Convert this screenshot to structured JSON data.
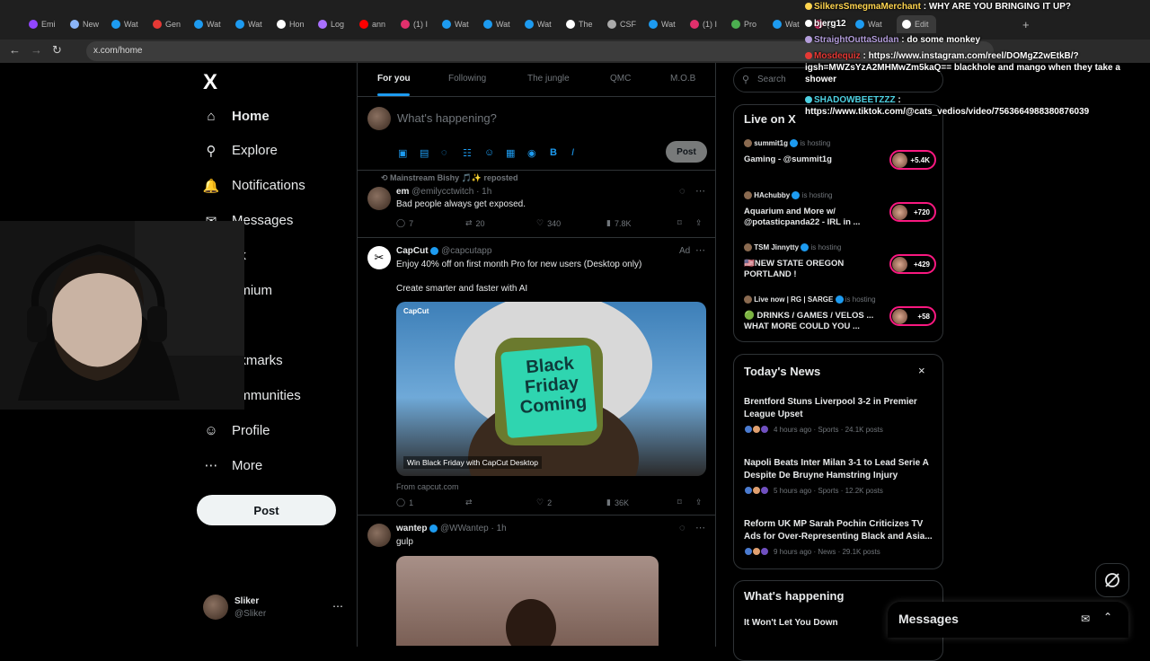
{
  "browser": {
    "url": "x.com/home",
    "tabs": [
      {
        "label": "Emi",
        "color": "#9146ff"
      },
      {
        "label": "New",
        "color": "#8ab4f8"
      },
      {
        "label": "Wat",
        "color": "#1d9bf0"
      },
      {
        "label": "Gen",
        "color": "#e53935"
      },
      {
        "label": "Wat",
        "color": "#1d9bf0"
      },
      {
        "label": "Wat",
        "color": "#1d9bf0"
      },
      {
        "label": "Hon",
        "color": "#ffffff"
      },
      {
        "label": "Log",
        "color": "#a970ff"
      },
      {
        "label": "ann",
        "color": "#ff0000"
      },
      {
        "label": "(1) I",
        "color": "#e1306c"
      },
      {
        "label": "Wat",
        "color": "#1d9bf0"
      },
      {
        "label": "Wat",
        "color": "#1d9bf0"
      },
      {
        "label": "Wat",
        "color": "#1d9bf0"
      },
      {
        "label": "The",
        "color": "#ffffff"
      },
      {
        "label": "CSF",
        "color": "#aaaaaa"
      },
      {
        "label": "Wat",
        "color": "#1d9bf0"
      },
      {
        "label": "(1) I",
        "color": "#e1306c"
      },
      {
        "label": "Pro",
        "color": "#4caf50"
      },
      {
        "label": "Wat",
        "color": "#1d9bf0"
      },
      {
        "label": "(1) I",
        "color": "#e1306c"
      },
      {
        "label": "Wat",
        "color": "#1d9bf0"
      },
      {
        "label": "Edit",
        "color": "#ffffff"
      }
    ]
  },
  "nav": {
    "logo": "X",
    "items": [
      {
        "label": "Home",
        "icon": "home-icon",
        "glyph": "⌂"
      },
      {
        "label": "Explore",
        "icon": "search-icon",
        "glyph": "⚲"
      },
      {
        "label": "Notifications",
        "icon": "bell-icon",
        "glyph": "🔔"
      },
      {
        "label": "Messages",
        "icon": "mail-icon",
        "glyph": "✉"
      },
      {
        "label": "ok",
        "icon": "grok-icon",
        "glyph": "◩"
      },
      {
        "label": "emium",
        "icon": "premium-icon",
        "glyph": "✕"
      },
      {
        "label": "ts",
        "icon": "lists-icon",
        "glyph": "☰"
      },
      {
        "label": "okmarks",
        "icon": "bookmark-icon",
        "glyph": "⌑"
      },
      {
        "label": "ommunities",
        "icon": "communities-icon",
        "glyph": "👥"
      },
      {
        "label": "Profile",
        "icon": "person-icon",
        "glyph": "☺"
      },
      {
        "label": "More",
        "icon": "more-icon",
        "glyph": "⋯"
      }
    ],
    "post_label": "Post",
    "account": {
      "name": "Sliker",
      "handle": "@Sliker"
    }
  },
  "feed": {
    "tabs": [
      "For you",
      "Following",
      "The jungle",
      "QMC",
      "M.O.B"
    ],
    "composer_placeholder": "What's happening?",
    "composer_post": "Post",
    "posts": [
      {
        "repost_by": "Mainstream Bishy 🎵✨ reposted",
        "name": "em",
        "handle": "@emilycctwitch",
        "time": "· 1h",
        "text": "Bad people always get exposed.",
        "replies": "7",
        "reposts": "20",
        "likes": "340",
        "views": "7.8K"
      },
      {
        "name": "CapCut",
        "handle": "@capcutapp",
        "ad": "Ad",
        "text1": "Enjoy 40% off on first month Pro for new users (Desktop only)",
        "text2": "Create smarter and faster with AI",
        "image_brand": "CapCut",
        "image_note": "Black Friday Coming",
        "image_caption": "Win Black Friday with CapCut Desktop",
        "source": "From capcut.com",
        "replies": "1",
        "reposts": "",
        "likes": "2",
        "views": "36K"
      },
      {
        "name": "wantep",
        "handle": "@WWantep",
        "time": "· 1h",
        "text": "gulp"
      }
    ]
  },
  "sidebar": {
    "search_placeholder": "Search",
    "live_title": "Live on X",
    "live": [
      {
        "host": "summit1g",
        "status": "is hosting",
        "title": "Gaming - @summit1g",
        "count": "+5.4K"
      },
      {
        "host": "HAchubby",
        "status": "is hosting",
        "title": "Aquarium and More w/ @potasticpanda22 - IRL in ...",
        "count": "+720"
      },
      {
        "host": "TSM Jinnytty",
        "status": "is hosting",
        "title": "🇺🇸NEW STATE OREGON PORTLAND !",
        "count": "+429"
      },
      {
        "host": "Live now | RG | SARGE",
        "status": "is hosting",
        "title": "🟢 DRINKS / GAMES / VELOS ... WHAT MORE COULD YOU ...",
        "count": "+58"
      }
    ],
    "news_title": "Today's News",
    "news": [
      {
        "title": "Brentford Stuns Liverpool 3-2 in Premier League Upset",
        "meta": "4 hours ago · Sports · 24.1K posts"
      },
      {
        "title": "Napoli Beats Inter Milan 3-1 to Lead Serie A Despite De Bruyne Hamstring Injury",
        "meta": "5 hours ago · Sports · 12.2K posts"
      },
      {
        "title": "Reform UK MP Sarah Pochin Criticizes TV Ads for Over-Representing Black and Asia...",
        "meta": "9 hours ago · News · 29.1K posts"
      }
    ],
    "happening_title": "What's happening",
    "happening_first": "It Won't Let You Down",
    "messages_label": "Messages"
  },
  "chat": [
    {
      "name": "SilkersSmegmaMerchant",
      "msg": "WHY ARE YOU BRINGING IT UP?",
      "color": "#ffd54f"
    },
    {
      "name": "bjerg12",
      "msg": "",
      "color": "#ffffff"
    },
    {
      "name": "StraightOuttaSudan",
      "msg": "do some monkey",
      "color": "#b39ddb"
    },
    {
      "name": "Mosdequiz",
      "msg": "https://www.instagram.com/reel/DOMgZ2wEtkB/?igsh=MWZsYzA2MHMwZm5kaQ== blackhole and mango when they take a shower",
      "color": "#e53935"
    },
    {
      "name": "SHADOWBEETZZZ",
      "msg": "https://www.tiktok.com/@cats_vedios/video/7563664988380876039",
      "color": "#4dd0e1"
    }
  ]
}
